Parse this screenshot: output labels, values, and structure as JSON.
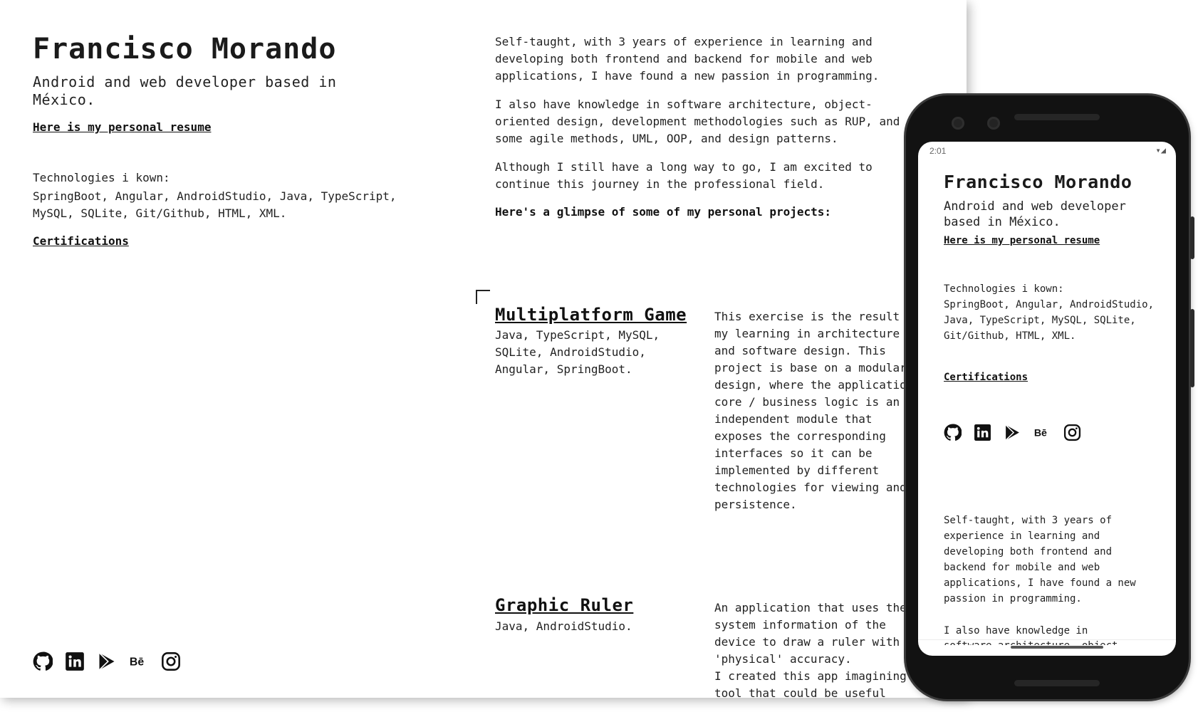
{
  "profile": {
    "name": "Francisco Morando",
    "tagline": "Android and web developer based in México.",
    "resume_link": "Here is my personal resume",
    "technologies_title": "Technologies i kown:",
    "technologies_list": "SpringBoot, Angular, AndroidStudio, Java, TypeScript, MySQL, SQLite, Git/Github, HTML, XML.",
    "certifications_link": "Certifications"
  },
  "social": [
    "github-icon",
    "linkedin-icon",
    "google-play-icon",
    "behance-icon",
    "instagram-icon"
  ],
  "about": {
    "p1": "Self-taught, with 3 years of experience in learning and developing both frontend and backend for mobile and web applications, I have found a new passion in programming.",
    "p2": "I also have knowledge in software architecture, object-oriented design, development methodologies such as RUP, and some agile methods, UML, OOP, and design patterns.",
    "p3": "Although I still have a long way to go, I am excited to continue this journey in the professional field.",
    "glimpse": "Here's a glimpse of some of my personal projects:"
  },
  "projects": [
    {
      "title": "Multiplatform Game",
      "tech": "Java, TypeScript, MySQL, SQLite, AndroidStudio, Angular, SpringBoot.",
      "description": "This exercise is the result of my learning in architecture and software design. This project is base on a modular design, where the application core / business logic is an independent module that exposes the corresponding interfaces so it can be implemented by different technologies for viewing and persistence."
    },
    {
      "title": "Graphic Ruler",
      "tech": "Java, AndroidStudio.",
      "description_1": "An application that uses the system information of the device to draw a ruler with 'physical' accuracy.",
      "description_2": "I created this app imagining a tool that could be useful"
    }
  ],
  "phone": {
    "time": "2:01",
    "status_icons": "▾◢",
    "name": "Francisco Morando",
    "tagline": "Android and web developer based in México.",
    "resume_link": "Here is my personal resume",
    "technologies_title": "Technologies i kown:",
    "technologies_list": "SpringBoot, Angular, AndroidStudio, Java, TypeScript, MySQL, SQLite, Git/Github, HTML, XML.",
    "certifications_link": "Certifications",
    "about_p1": "Self-taught, with 3 years of experience in learning and developing both frontend and backend for mobile and web applications, I have found a new passion in programming.",
    "about_p2_start": "I also have knowledge in",
    "about_p2_cut": "software architecture, object"
  },
  "colors": {
    "text": "#222222",
    "phone_body": "#121212",
    "background": "#ffffff"
  }
}
